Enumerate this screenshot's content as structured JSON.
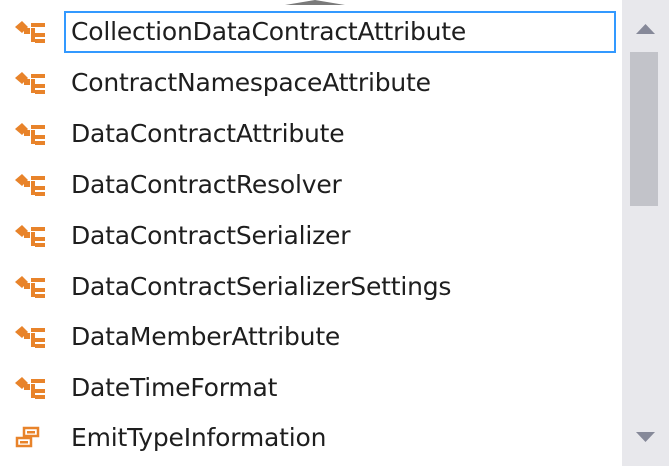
{
  "completion_list": {
    "items": [
      {
        "label": "CollectionDataContractAttribute",
        "icon": "class-attribute-icon",
        "selected": true
      },
      {
        "label": "ContractNamespaceAttribute",
        "icon": "class-attribute-icon",
        "selected": false
      },
      {
        "label": "DataContractAttribute",
        "icon": "class-attribute-icon",
        "selected": false
      },
      {
        "label": "DataContractResolver",
        "icon": "class-attribute-icon",
        "selected": false
      },
      {
        "label": "DataContractSerializer",
        "icon": "class-attribute-icon",
        "selected": false
      },
      {
        "label": "DataContractSerializerSettings",
        "icon": "class-attribute-icon",
        "selected": false
      },
      {
        "label": "DataMemberAttribute",
        "icon": "class-attribute-icon",
        "selected": false
      },
      {
        "label": "DateTimeFormat",
        "icon": "class-attribute-icon",
        "selected": false
      },
      {
        "label": "EmitTypeInformation",
        "icon": "enum-icon",
        "selected": false
      }
    ]
  },
  "scrollbar": {
    "up_icon": "scroll-up-arrow-icon",
    "down_icon": "scroll-down-arrow-icon"
  },
  "colors": {
    "selection_border": "#3399ff",
    "class_icon": "#e8832a",
    "scrollbar_track": "#e8e8ec",
    "scrollbar_thumb": "#c2c3c9"
  }
}
